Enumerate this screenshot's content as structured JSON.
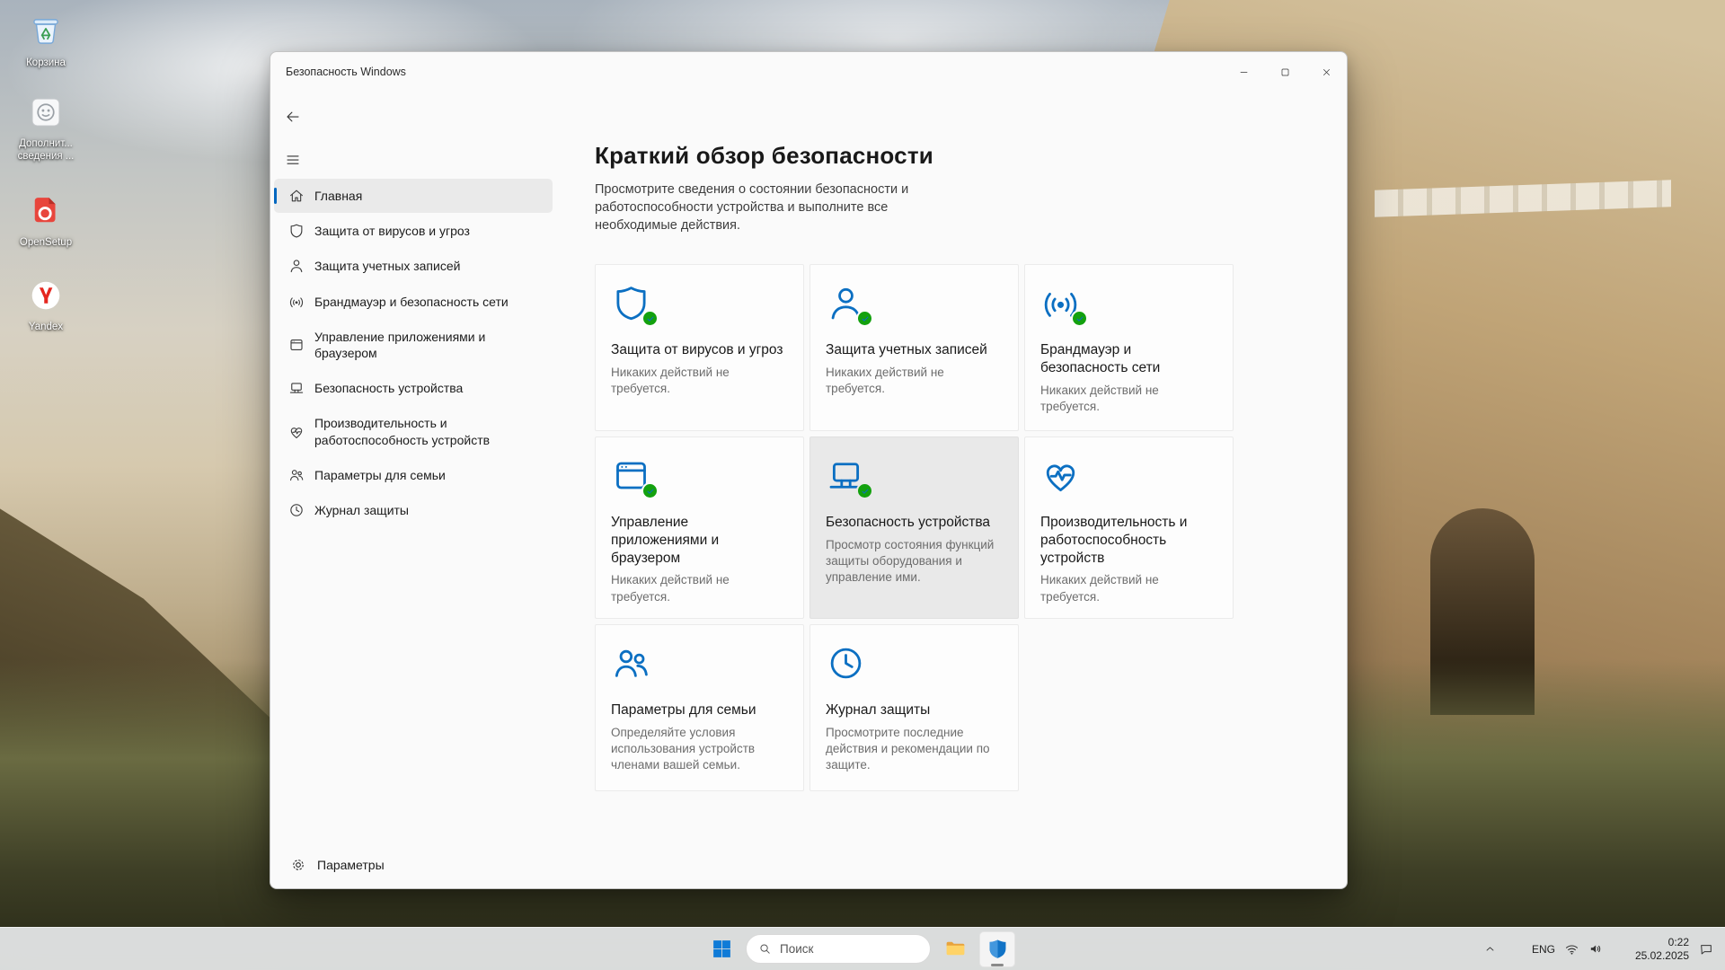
{
  "desktop": {
    "icons": [
      {
        "label": "Корзина"
      },
      {
        "label_lines": [
          "Дополнит...",
          "сведения ..."
        ]
      },
      {
        "label": "OpenSetup"
      },
      {
        "label": "Yandex"
      }
    ]
  },
  "window": {
    "title": "Безопасность Windows",
    "sidebar": {
      "items": [
        {
          "label": "Главная"
        },
        {
          "label": "Защита от вирусов и угроз"
        },
        {
          "label": "Защита учетных записей"
        },
        {
          "label": "Брандмауэр и безопасность сети"
        },
        {
          "label": "Управление приложениями и браузером"
        },
        {
          "label": "Безопасность устройства"
        },
        {
          "label": "Производительность и работоспособность устройств"
        },
        {
          "label": "Параметры для семьи"
        },
        {
          "label": "Журнал защиты"
        }
      ],
      "settings_label": "Параметры"
    },
    "main": {
      "title": "Краткий обзор безопасности",
      "subtitle": "Просмотрите сведения о состоянии безопасности и работоспособности устройства и выполните все необходимые действия.",
      "cards": [
        {
          "title": "Защита от вирусов и угроз",
          "status": "Никаких действий не требуется."
        },
        {
          "title": "Защита учетных записей",
          "status": "Никаких действий не требуется."
        },
        {
          "title": "Брандмауэр и безопасность сети",
          "status": "Никаких действий не требуется."
        },
        {
          "title": "Управление приложениями и браузером",
          "status": "Никаких действий не требуется."
        },
        {
          "title": "Безопасность устройства",
          "status": "Просмотр состояния функций защиты оборудования и управление ими."
        },
        {
          "title": "Производительность и работоспособность устройств",
          "status": "Никаких действий не требуется."
        },
        {
          "title": "Параметры для семьи",
          "status": "Определяйте условия использования устройств членами вашей семьи."
        },
        {
          "title": "Журнал защиты",
          "status": "Просмотрите последние действия и рекомендации по защите."
        }
      ]
    }
  },
  "taskbar": {
    "search_placeholder": "Поиск",
    "tray": {
      "lang": "ENG",
      "time": "0:22",
      "date": "25.02.2025"
    }
  },
  "colors": {
    "accent": "#0067c0",
    "icon_blue": "#0b6fc2",
    "success_green": "#13a10e"
  }
}
